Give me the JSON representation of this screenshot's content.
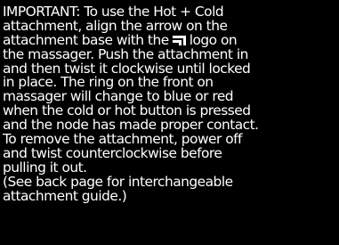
{
  "theme": {
    "background": "#000000",
    "text_color": "#ffffff"
  },
  "instructions": {
    "lines": [
      "IMPORTANT: To use the Hot + Cold",
      "attachment, align the arrow on the",
      "attachment base with the",
      "logo on",
      "the massager.  Push the attachment in",
      "and then twist it clockwise until locked",
      "in place. The ring on the front on",
      "massager will change to blue or red",
      "when the cold or hot button is pressed",
      "and the node has made proper contact.",
      "To remove the attachment, power off",
      "and twist counterclockwise before",
      "pulling it out.",
      "(See back page for interchangeable",
      "attachment guide.)"
    ],
    "logo_icon": "brand-logo-icon"
  }
}
